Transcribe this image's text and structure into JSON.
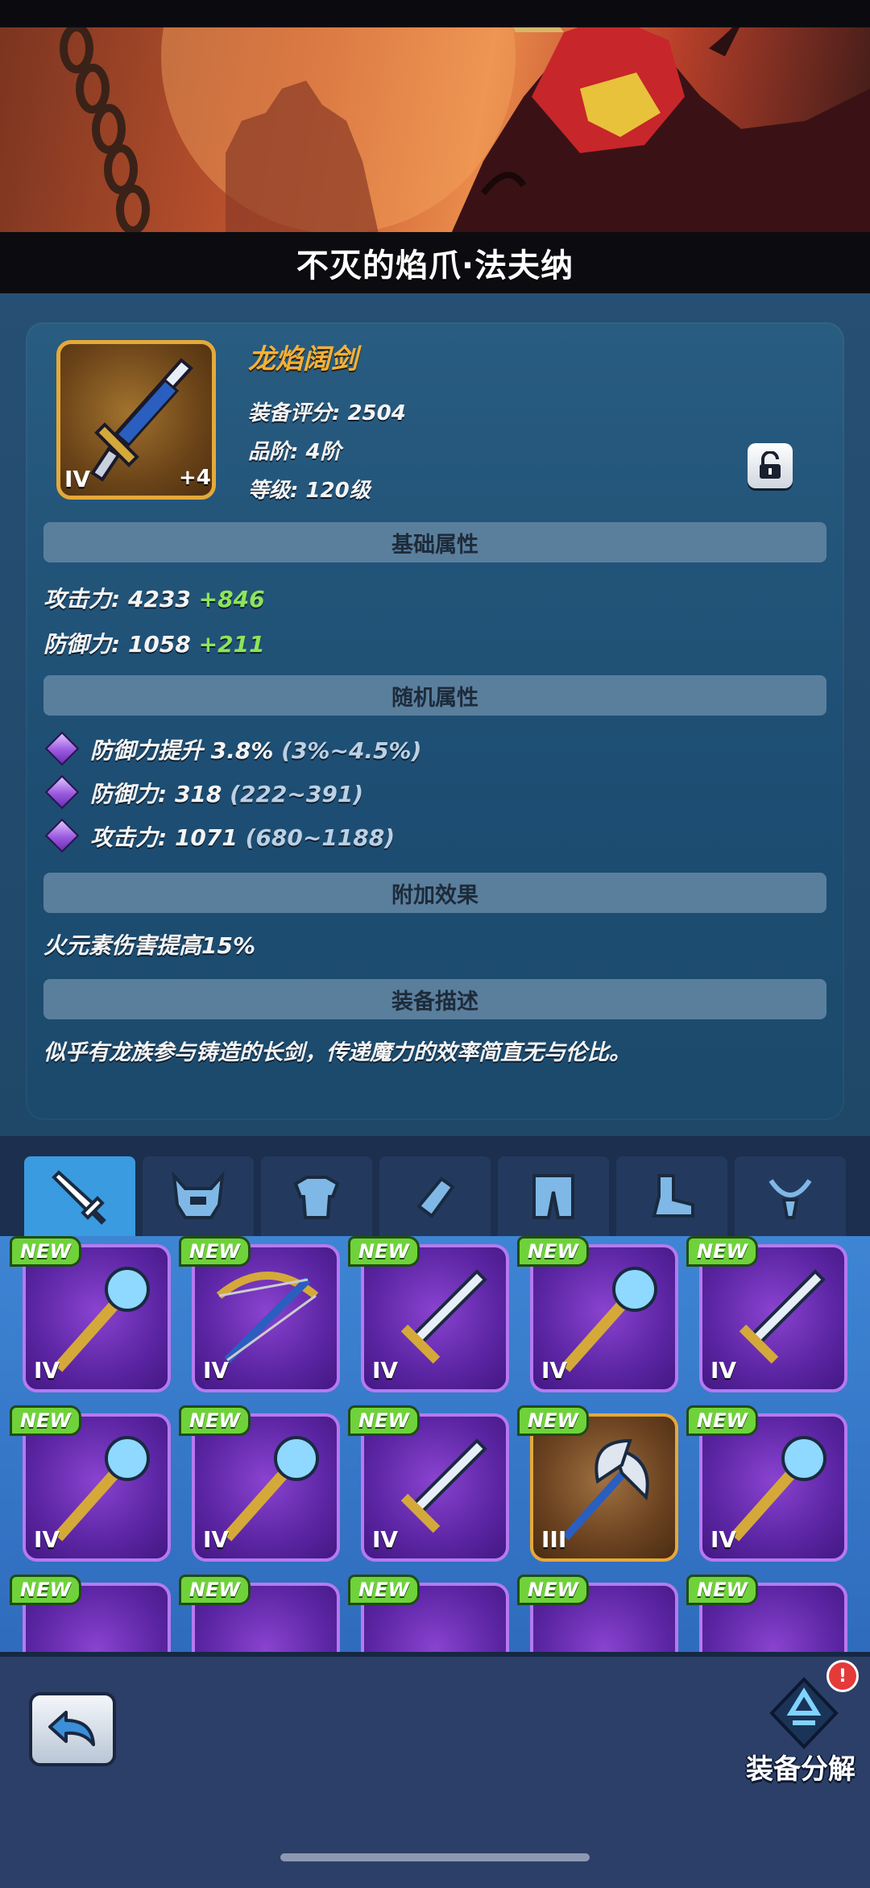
{
  "hero": {
    "title": "不灭的焰爪·法夫纳"
  },
  "item": {
    "name": "龙焰阔剑",
    "tier": "IV",
    "enhance": "+4",
    "score_label": "装备评分:",
    "score_value": "2504",
    "grade_label": "品阶:",
    "grade_value": "4阶",
    "level_label": "等级:",
    "level_value": "120级"
  },
  "sections": {
    "base": "基础属性",
    "random": "随机属性",
    "bonus": "附加效果",
    "desc": "装备描述"
  },
  "base_stats": [
    {
      "label": "攻击力:",
      "value": "4233",
      "plus": "+846"
    },
    {
      "label": "防御力:",
      "value": "1058",
      "plus": "+211"
    }
  ],
  "random_stats": [
    {
      "text": "防御力提升 3.8%",
      "range": "(3%~4.5%)"
    },
    {
      "text": "防御力: 318",
      "range": "(222~391)"
    },
    {
      "text": "攻击力: 1071",
      "range": "(680~1188)"
    }
  ],
  "bonus_text": "火元素伤害提高15%",
  "description": "似乎有龙族参与铸造的长剑，传递魔力的效率简直无与伦比。",
  "tabs": [
    "sword-icon",
    "helmet-icon",
    "armor-icon",
    "gauntlet-icon",
    "pants-icon",
    "boots-icon",
    "necklace-icon"
  ],
  "inventory": {
    "new_label": "NEW",
    "rows": [
      [
        {
          "tier": "IV",
          "icon": "staff-icon"
        },
        {
          "tier": "IV",
          "icon": "crossbow-icon"
        },
        {
          "tier": "IV",
          "icon": "sword-icon"
        },
        {
          "tier": "IV",
          "icon": "staff-icon"
        },
        {
          "tier": "IV",
          "icon": "sword-icon"
        }
      ],
      [
        {
          "tier": "IV",
          "icon": "staff-icon"
        },
        {
          "tier": "IV",
          "icon": "staff-icon"
        },
        {
          "tier": "IV",
          "icon": "sword-icon"
        },
        {
          "tier": "III",
          "icon": "axe-icon",
          "gold": true
        },
        {
          "tier": "IV",
          "icon": "staff-icon"
        }
      ]
    ]
  },
  "bottom": {
    "decompose_label": "装备分解",
    "badge": "!"
  }
}
